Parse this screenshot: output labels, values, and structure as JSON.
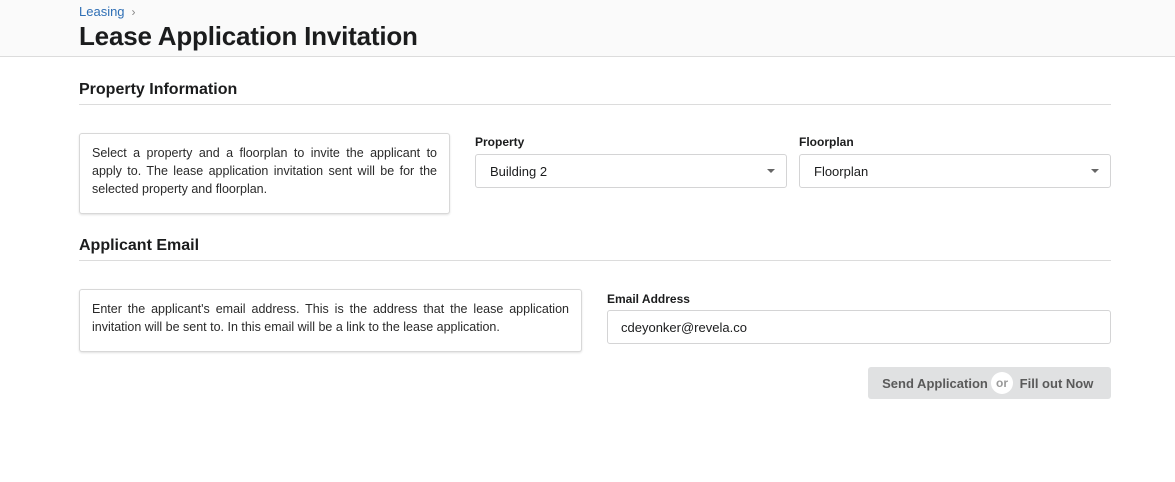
{
  "breadcrumb": {
    "parent": "Leasing",
    "separator": "›"
  },
  "page": {
    "title": "Lease Application Invitation"
  },
  "property_section": {
    "title": "Property Information",
    "info": "Select a property and a floorplan to invite the applicant to apply to. The lease application invitation sent will be for the selected property and floorplan.",
    "property_label": "Property",
    "property_value": "Building 2",
    "floorplan_label": "Floorplan",
    "floorplan_value": "Floorplan"
  },
  "email_section": {
    "title": "Applicant Email",
    "info": "Enter the applicant's email address. This is the address that the lease application invitation will be sent to. In this email will be a link to the lease application.",
    "email_label": "Email Address",
    "email_value": "cdeyonker@revela.co"
  },
  "actions": {
    "send_label": "Send Application",
    "or_label": "or",
    "fill_label": "Fill out Now"
  },
  "colors": {
    "link": "#2f6fb5",
    "button_bg": "#e0e1e2"
  }
}
